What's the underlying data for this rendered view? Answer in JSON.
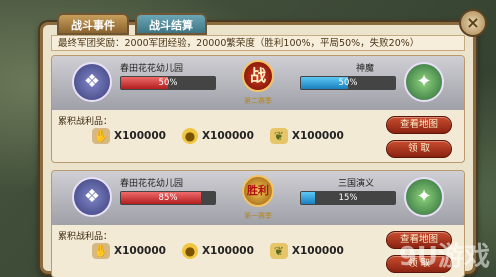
{
  "tabs": [
    "战斗事件",
    "战斗结算"
  ],
  "summary": "最终军团奖励：2000军团经验，20000繁荣度（胜利100%，平局50%，失败20%）",
  "battles": [
    {
      "left_team": "春田花花幼儿园",
      "right_team": "神魔",
      "left_pct": "50%",
      "right_pct": "50%",
      "left_fill": 50,
      "right_fill": 50,
      "badge": "战",
      "season": "第二赛季",
      "rewards_label": "累积战利品：",
      "rewards": [
        "X100000",
        "X100000",
        "X100000"
      ],
      "view_button": "查看地图",
      "claim_button": "领 取"
    },
    {
      "left_team": "春田花花幼儿园",
      "right_team": "三国演义",
      "left_pct": "85%",
      "right_pct": "15%",
      "left_fill": 85,
      "right_fill": 15,
      "badge": "胜利",
      "season": "第一赛季",
      "rewards_label": "累积战利品：",
      "rewards": [
        "X100000",
        "X100000",
        "X100000"
      ],
      "view_button": "查看地图",
      "claim_button": "领 取"
    }
  ],
  "close_label": "×",
  "watermark": "9U游戏"
}
